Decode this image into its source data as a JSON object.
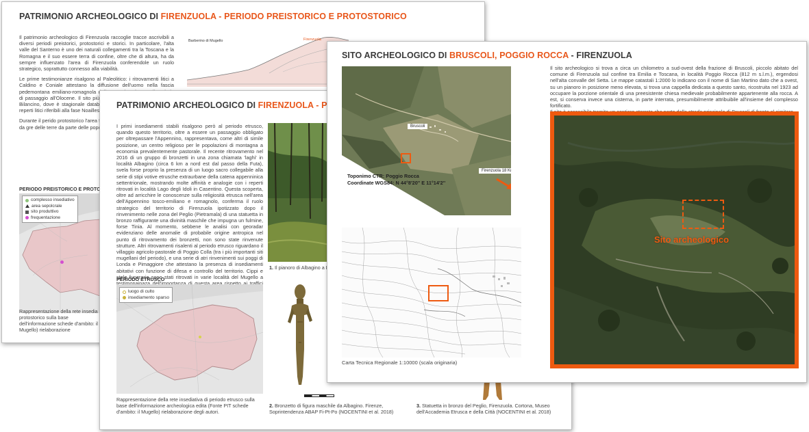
{
  "sheet1": {
    "title_prefix": "PATRIMONIO ARCHEOLOGICO DI ",
    "title_highlight": "FIRENZUOLA - PERIODO PREISTORICO E PROTOSTORICO",
    "paragraphs": [
      "Il patrimonio archeologico di Firenzuola raccoglie tracce ascrivibili a diversi periodi preistorici, protostorici e storici. In particolare, l'alta valle del Santerno è uno dei naturali collegamenti tra la Toscana e la Romagna e il suo essere terra di confine, oltre che di altura, ha da sempre influenzato l'area di Firenzuola conferendole un ruolo strategico, soprattutto connesso alla viabilità.",
      "Le prime testimonianze risalgono al Paleolitico: i ritrovamenti litici a Caldino e Coniale attestano la diffusione dell'uomo nella fascia pedemontana emiliano-romagnola dell'Appennino durante il periodo di passaggio all'Olocene. Il sito più significativo è quello del lago di Bilancino, dove è stagionale databile 25.000-30.000 anni numerosi reperti litici riferibili alla fase Noailles\" che rappresenta un unicum in",
      "Durante il perido protostorico l'area fre occupata dai liguri, e occupata da gre delle terre da parte delle popolazioni et"
    ],
    "legend_heading": "PERIODO PREISTORICO E PROTOSTOR",
    "legend_items": [
      "complesso insediativo",
      "area sepolcrale",
      "sito produttivo",
      "frequentazione"
    ],
    "bottom_caption": "Rappresentazione della rete insedia protostorico sulla base dell'informazione schede d'ambito: il Mugello) rielaborazione",
    "profile_label_a": "Barberino di Mugello",
    "profile_label_b": "Firenzuola"
  },
  "sheet2": {
    "title_prefix": "PATRIMONIO ARCHEOLOGICO DI ",
    "title_highlight": "FIRENZUOLA - PERIODO E",
    "paragraph": "I primi insediamenti stabili risalgono però al periodo etrusco, quando questo territorio, oltre a essere un passaggio obbligato per oltrepassare l'Appennino, rappresentava, come altri di simile posizione, un centro religioso per le popolazioni di montagna a economia prevalentemente pastorale. Il recente ritrovamento nel 2016 di un gruppo di bronzetti in una zona chiamata 'laghi' in località Albagino (circa 6 km a nord est dal passo della Futa), svela forse proprio la presenza di un luogo sacro collegabile alla serie di stipi votive etrusche extraurbane della catena appenninica settentrionale, mostrando molte affinità e analogie con i reperti ritrovati in località Lago degli Idoli in Casentino. Questa scoperta, oltre ad arricchire le conoscenze sulla religiosità etrusca nell'area dell'Appennino tosco-emiliano e romagnolo, conferma il ruolo strategico del territorio di Firenzuola ipotizzato dopo il rinvenimento nelle zona del Peglio (Pietramala) di una statuetta in bronzo raffigurante una divinità maschile che impugna un fulmine, forse Tinia. Al momento, sebbene le analisi con georadar evidenziano delle anomalie di probabile origine antropica nel punto di ritrovamento dei bronzetti, non sono state rinvenute strutture. Altri ritrovamenti risalenti al periodo etrusco riguardano il villaggio agricolo-pastorale di Poggio Colla (tra i più importanti siti mugellani del periodo), e una serie di atri rinvenimenti sui poggi di Londa e Pimaggiore che attestano la presenza di insediamenti abitativi con funzione di difesa e controllo del territorio. Cippi e stele funerarie sono stati ritrovati in varie località del Mugello a testimonainaza dell'importanza di questa area rispetto ai traffici commerciali tra area tirrenica ed adriatica.",
    "map_heading": "PERIODO ETRUSCO",
    "legend_items": [
      "luogo di culto",
      "insediamento sparso"
    ],
    "map_caption": "Rappresentazione della rete insediativa di periodo etrusco sulla base dell'informazione archeologica edita (Fonte PIT schede d'ambito: il Mugello) rielaborazione degli autori.",
    "photo_caption_num": "1.",
    "photo_caption_text": " Il pianoro di Albagino a Fir",
    "statue_caption_num": "2.",
    "statue_caption_text": " Bronzetto di figura maschile da Albagino. Firenze, Soprintendenza ABAP Fi-Pt-Po (NOCENTINI et al. 2018)",
    "statue3_caption_num": "3.",
    "statue3_caption_text": " Statuetta in bronzo del Peglio, Firenzuola. Cortona, Museo dell'Accademia Etrusca e della Città (NOCENTINI et al. 2018)"
  },
  "sheet3": {
    "title_prefix": "SITO ARCHEOLOGICO DI ",
    "title_highlight": "BRUSCOLI, POGGIO ROCCA",
    "title_suffix": " - FIRENZUOLA",
    "paragraphs": [
      "Il sito archeologico si trova a circa un chilometro a sud-ovest della frazione di Bruscoli, piccolo abitato del comune di Firenzuola sul confine tra Emilia e Toscana, in località Poggio Rocca (812 m s.l.m.), ergendosi nell'alta convalle del Setta. Le mappe catastali 1:2000 lo indicano con il nome di San Martino dato che a ovest, su un pianoro in posizione meno elevata, si trova una cappella dedicata a questo santo, ricostruita nel 1923 ad occupare la porzione orientale di una preesistente chiesa medievale probabilmente appartenente alla rocca. A est, si conserva invece una cisterna, in parte interrata, presumibilmente attribuibile all'insieme del complesso fortificato.",
      "Il sito è accessibile tramite un sentiero sterrato che parte dalla strada principale di Bruscoli di fronte al cimitero."
    ],
    "label_bruscoli": "Bruscoli",
    "label_firenzuola": "Firenzuola 18 Km",
    "toponimo": "Toponimo CTR: Poggio Rocca",
    "coordinate": "Coordinate  WGS84: N 44°8'20'' E 11°14'2''",
    "ctr_caption": "Carta Tecnica Regionale 1:10000 (scala originaria)",
    "site_label": "Sito archeologico"
  },
  "colors": {
    "accent": "#e8561a",
    "map_fill": "#e9c7c9",
    "forest_dark": "#2f3d24"
  }
}
